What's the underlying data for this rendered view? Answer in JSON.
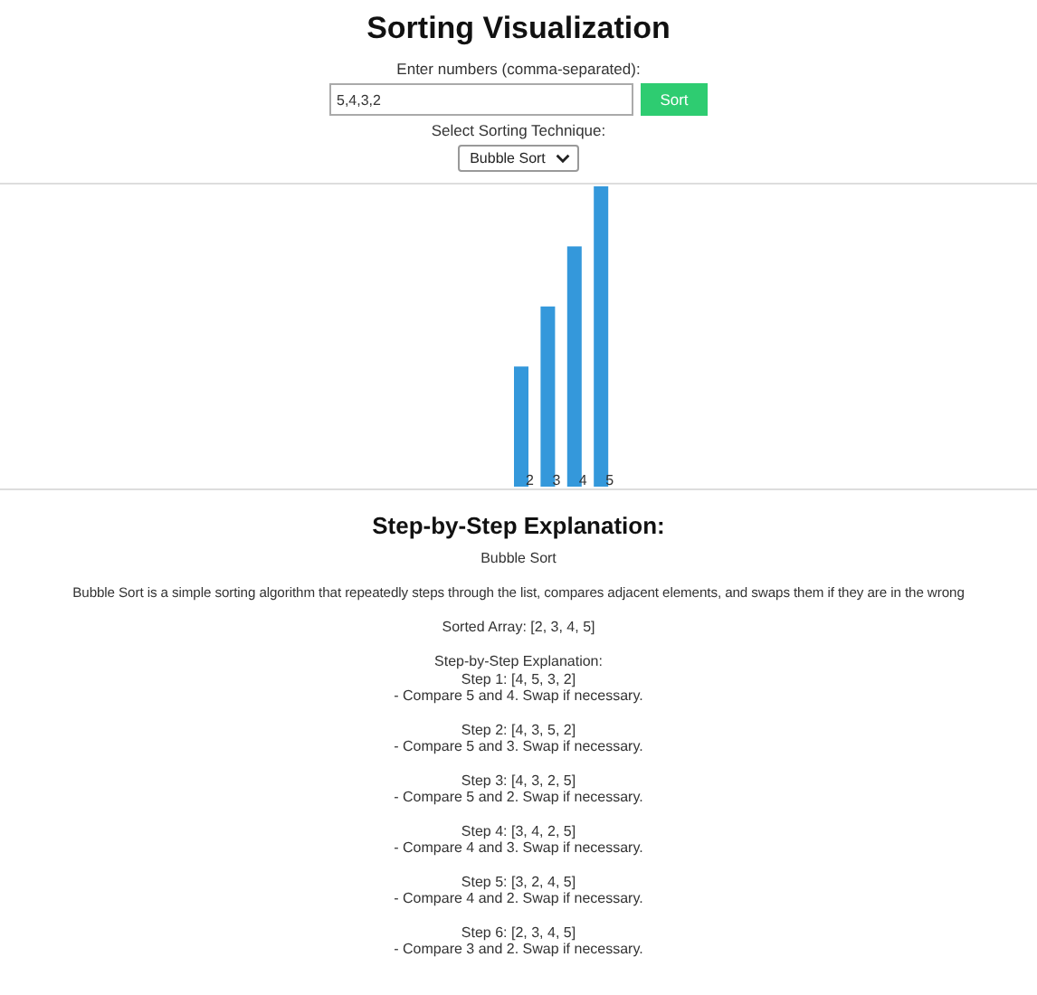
{
  "title": "Sorting Visualization",
  "input": {
    "label": "Enter numbers (comma-separated):",
    "value": "5,4,3,2",
    "button": "Sort"
  },
  "technique": {
    "label": "Select Sorting Technique:",
    "value": "Bubble Sort"
  },
  "chart_data": {
    "type": "bar",
    "categories": [
      null,
      null,
      null,
      null
    ],
    "series": [
      {
        "color": "#3498db",
        "values": [
          2,
          3,
          4,
          5
        ]
      }
    ],
    "data_labels": true
  },
  "explanation": {
    "heading": "Step-by-Step Explanation:",
    "algorithm": "Bubble Sort",
    "description": "Bubble Sort is a simple sorting algorithm that repeatedly steps through the list, compares adjacent elements, and swaps them if they are in the wrong",
    "sorted": "Sorted Array: [2, 3, 4, 5]",
    "steps_heading": "Step-by-Step Explanation:",
    "steps": [
      {
        "step": "Step 1: [4, 5, 3, 2]",
        "note": "- Compare 5 and 4. Swap if necessary."
      },
      {
        "step": "Step 2: [4, 3, 5, 2]",
        "note": "- Compare 5 and 3. Swap if necessary."
      },
      {
        "step": "Step 3: [4, 3, 2, 5]",
        "note": "- Compare 5 and 2. Swap if necessary."
      },
      {
        "step": "Step 4: [3, 4, 2, 5]",
        "note": "- Compare 4 and 3. Swap if necessary."
      },
      {
        "step": "Step 5: [3, 2, 4, 5]",
        "note": "- Compare 4 and 2. Swap if necessary."
      },
      {
        "step": "Step 6: [2, 3, 4, 5]",
        "note": "- Compare 3 and 2. Swap if necessary."
      }
    ]
  }
}
